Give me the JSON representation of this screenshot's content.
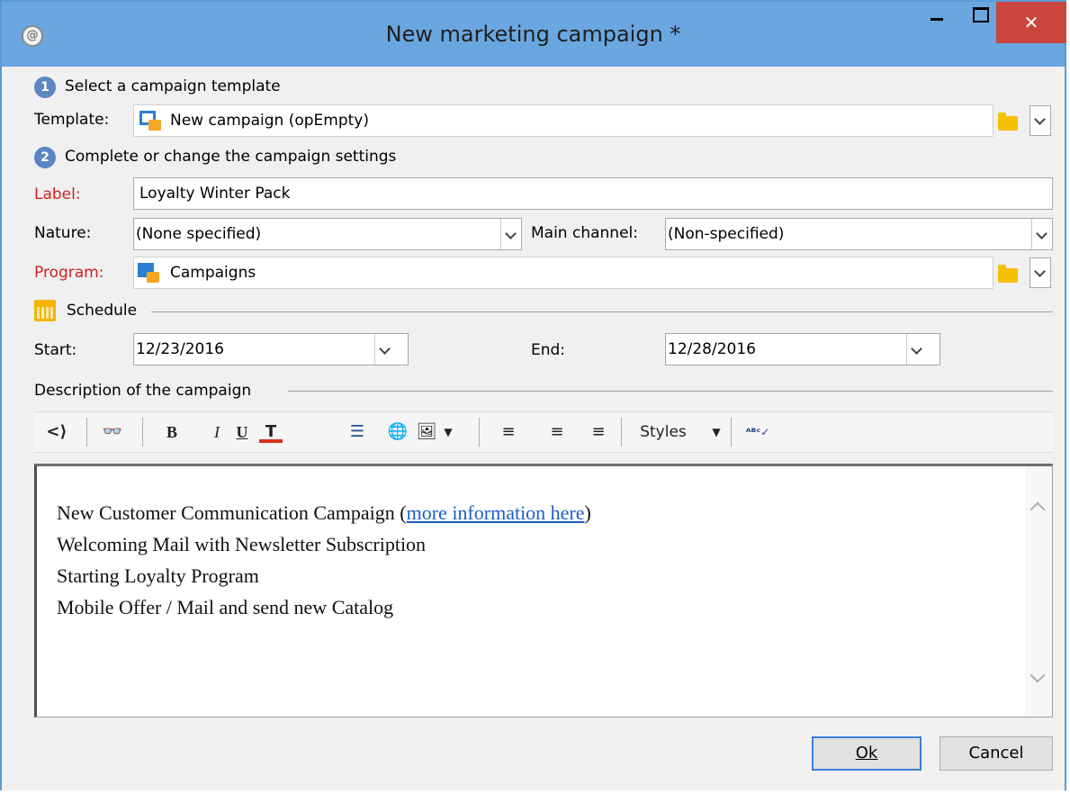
{
  "window": {
    "title": "New marketing campaign *",
    "minimize_label": "–",
    "maximize_label": "□",
    "close_label": "✕"
  },
  "steps": {
    "step1_number": "1",
    "step1_label": "Select a campaign template",
    "step2_number": "2",
    "step2_label": "Complete or change the campaign settings"
  },
  "form": {
    "template_label": "Template:",
    "template_value": "New campaign (opEmpty)",
    "label_label": "Label:",
    "label_value": "Loyalty Winter Pack",
    "nature_label": "Nature:",
    "nature_value": "(None specified)",
    "channel_label": "Main channel:",
    "channel_value": "(Non-specified)",
    "program_label": "Program:",
    "program_value": "Campaigns"
  },
  "schedule": {
    "section_label": "Schedule",
    "start_label": "Start:",
    "start_value": "12/23/2016",
    "end_label": "End:",
    "end_value": "12/28/2016"
  },
  "description": {
    "section_label": "Description of the campaign",
    "toolbar": {
      "source": "<⟩",
      "find": "👓",
      "bold": "B",
      "italic": "I",
      "underline": "U",
      "textcolor": "T",
      "list": "☰",
      "link": "🌐",
      "image": "🖼",
      "align_left": "≡",
      "align_center": "≡",
      "align_right": "≡",
      "styles": "Styles",
      "spell": "ᴬᴮᶜ✓"
    },
    "lines": {
      "line1_prefix": "New Customer Communication Campaign (",
      "line1_link": "more information here",
      "line1_suffix": ")",
      "line2": "Welcoming Mail with Newsletter Subscription",
      "line3": "Starting Loyalty Program",
      "line4": "Mobile Offer / Mail and send new Catalog"
    }
  },
  "buttons": {
    "ok_label": "Ok",
    "cancel_label": "Cancel"
  },
  "colors": {
    "titlebar": "#6aa6e0",
    "close": "#c9453d",
    "required_label": "#d22020",
    "link": "#1a5fc8"
  }
}
